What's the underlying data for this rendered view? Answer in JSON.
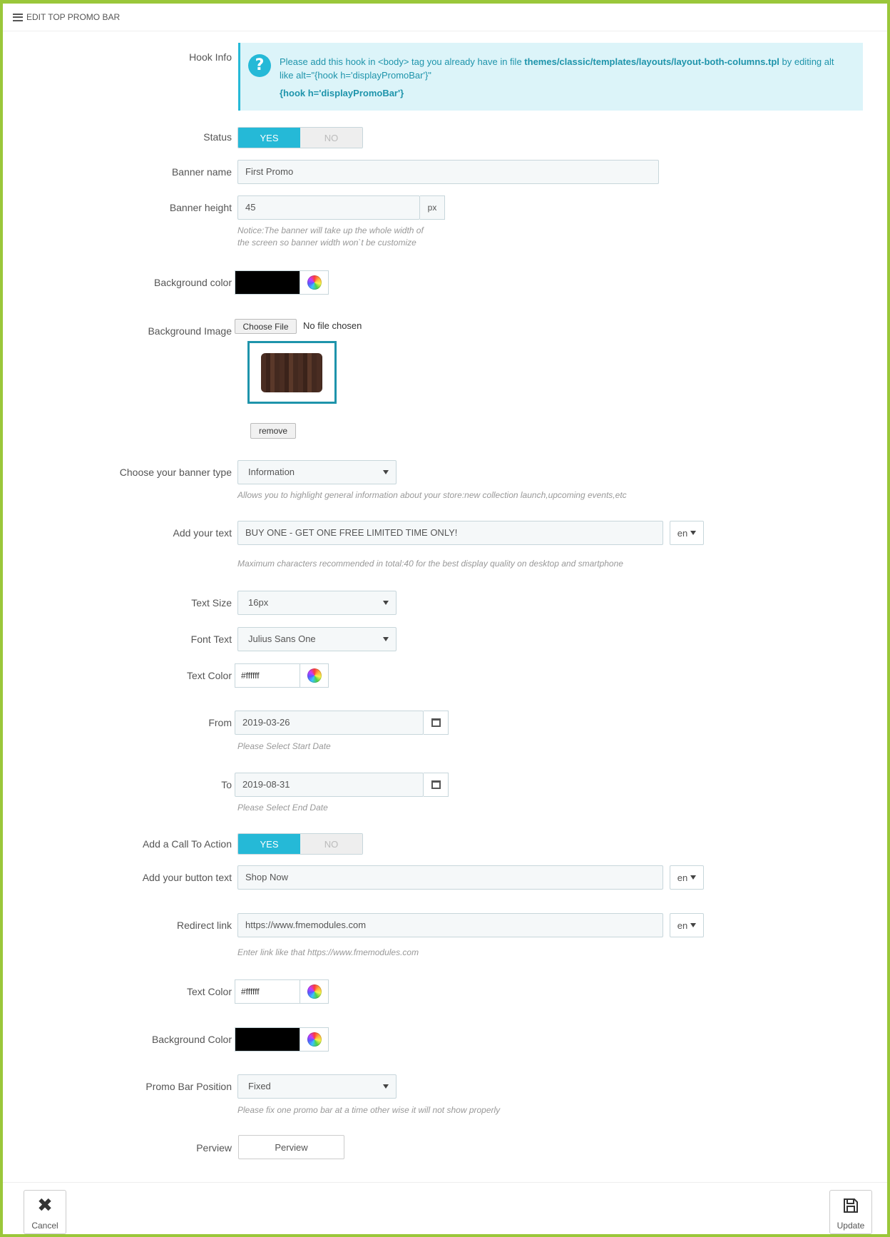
{
  "header": {
    "title": "EDIT TOP PROMO BAR"
  },
  "hook_info": {
    "label": "Hook Info",
    "text_prefix": "Please add this hook in <body> tag you already have in file ",
    "file": "themes/classic/templates/layouts/layout-both-columns.tpl",
    "text_suffix": " by editing alt like alt=\"{hook h='displayPromoBar'}\"",
    "code": "{hook h='displayPromoBar'}"
  },
  "status": {
    "label": "Status",
    "yes": "YES",
    "no": "NO"
  },
  "banner_name": {
    "label": "Banner name",
    "value": "First Promo"
  },
  "banner_height": {
    "label": "Banner height",
    "value": "45",
    "unit": "px",
    "help_line1": "Notice:The banner will take up the whole width of",
    "help_line2": "the screen so banner width won`t be customize"
  },
  "background_color": {
    "label": "Background color",
    "value": "#000000"
  },
  "background_image": {
    "label": "Background Image",
    "choose": "Choose File",
    "no_file": "No file chosen",
    "remove": "remove"
  },
  "banner_type": {
    "label": "Choose your banner type",
    "selected": "Information",
    "help": "Allows you to highlight general information about your store:new collection launch,upcoming events,etc"
  },
  "add_text": {
    "label": "Add your text",
    "value": "BUY ONE - GET ONE FREE LIMITED TIME ONLY!",
    "lang": "en",
    "help": "Maximum characters recommended in total:40 for the best display quality on desktop and smartphone"
  },
  "text_size": {
    "label": "Text Size",
    "selected": "16px"
  },
  "font_text": {
    "label": "Font Text",
    "selected": "Julius Sans One"
  },
  "text_color": {
    "label": "Text Color",
    "value": "#ffffff"
  },
  "from": {
    "label": "From",
    "value": "2019-03-26",
    "help": "Please Select Start Date"
  },
  "to": {
    "label": "To",
    "value": "2019-08-31",
    "help": "Please Select End Date"
  },
  "cta": {
    "label": "Add a Call To Action",
    "yes": "YES",
    "no": "NO"
  },
  "button_text": {
    "label": "Add your button text",
    "value": "Shop Now",
    "lang": "en"
  },
  "redirect": {
    "label": "Redirect link",
    "value": "https://www.fmemodules.com",
    "lang": "en",
    "help": "Enter link like that https://www.fmemodules.com"
  },
  "btn_text_color": {
    "label": "Text Color",
    "value": "#ffffff"
  },
  "btn_bg_color": {
    "label": "Background Color",
    "value": "#000000"
  },
  "position": {
    "label": "Promo Bar Position",
    "selected": "Fixed",
    "help": "Please fix one promo bar at a time other wise it will not show properly"
  },
  "preview": {
    "label": "Perview",
    "button": "Perview"
  },
  "footer": {
    "cancel": "Cancel",
    "update": "Update"
  },
  "colors": {
    "accent": "#25b9d7",
    "frame": "#9ac73a"
  }
}
